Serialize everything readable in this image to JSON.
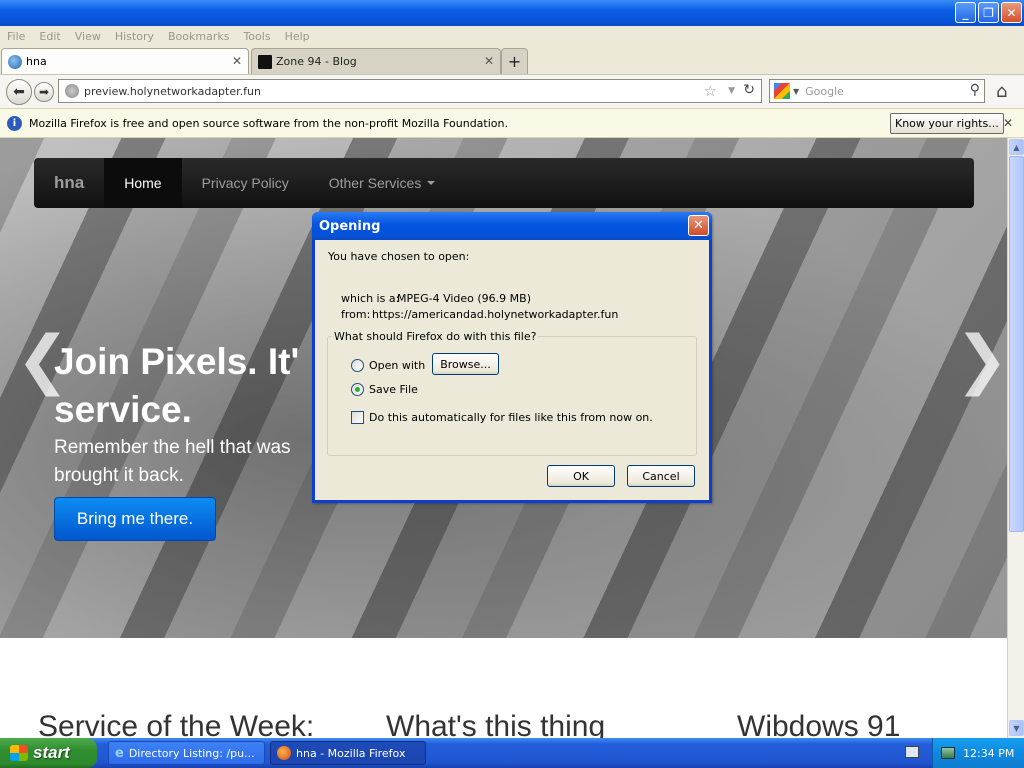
{
  "menubar": {
    "items": [
      "File",
      "Edit",
      "View",
      "History",
      "Bookmarks",
      "Tools",
      "Help"
    ]
  },
  "tabs": [
    {
      "label": "hna"
    },
    {
      "label": "Zone 94 - Blog"
    }
  ],
  "navbar": {
    "url": "preview.holynetworkadapter.fun",
    "search_placeholder": "Google"
  },
  "notification": {
    "text": "Mozilla Firefox is free and open source software from the non-profit Mozilla Foundation.",
    "button": "Know your rights..."
  },
  "site": {
    "nav": {
      "brand": "hna",
      "items": [
        "Home",
        "Privacy Policy",
        "Other Services"
      ]
    },
    "hero": {
      "heading_line1": "Join Pixels. It'",
      "heading_line2": "service.",
      "sub_line1": "Remember the hell that was",
      "sub_line2": "brought it back.",
      "button": "Bring me there."
    },
    "sections": [
      "Service of the Week:",
      "What's this thing",
      "Wibdows 91"
    ]
  },
  "dialog": {
    "title": "Opening",
    "intro": "You have chosen to open:",
    "which_label": "which is a:",
    "which_value": "MPEG-4 Video (96.9 MB)",
    "from_label": "from:",
    "from_value": "https://americandad.holynetworkadapter.fun",
    "group_label": "What should Firefox do with this file?",
    "open_with": "Open with",
    "browse": "Browse...",
    "save_file": "Save File",
    "auto_label": "Do this automatically for files like this from now on.",
    "ok": "OK",
    "cancel": "Cancel",
    "selected_option": "save_file"
  },
  "taskbar": {
    "start": "start",
    "items": [
      {
        "label": "Directory Listing: /pu..."
      },
      {
        "label": "hna - Mozilla Firefox"
      }
    ],
    "clock": "12:34 PM"
  }
}
